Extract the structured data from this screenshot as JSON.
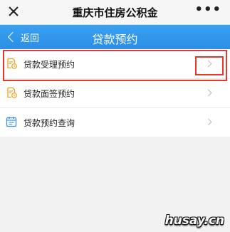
{
  "topbar": {
    "title": "重庆市住房公积金",
    "more_icon": "more-dots-icon",
    "close_icon": "close-icon",
    "more_text": "•••"
  },
  "navbar": {
    "back_label": "返回",
    "title": "贷款预约",
    "color": "#2a8fe6"
  },
  "menu": {
    "items": [
      {
        "label": "贷款受理预约",
        "icon": "document-clock-icon",
        "icon_color": "#f2a11a"
      },
      {
        "label": "贷款面签预约",
        "icon": "document-clock-icon",
        "icon_color": "#f2a11a"
      },
      {
        "label": "贷款预约查询",
        "icon": "calendar-icon",
        "icon_color": "#3a8ee6"
      }
    ]
  },
  "highlight_color": "#e8362d",
  "watermark": "husay.cn"
}
